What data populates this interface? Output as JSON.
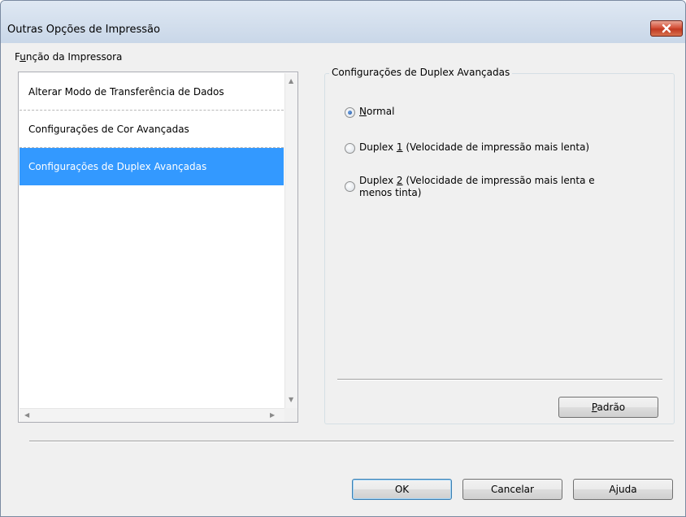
{
  "window": {
    "title": "Outras Opções de Impressão"
  },
  "left_panel": {
    "group_label_prefix": "F",
    "group_label_accel": "u",
    "group_label_suffix": "nção da Impressora",
    "items": [
      {
        "label": "Alterar Modo de Transferência de Dados",
        "selected": false
      },
      {
        "label": "Configurações de Cor Avançadas",
        "selected": false
      },
      {
        "label": "Configurações de Duplex Avançadas",
        "selected": true
      }
    ]
  },
  "right_panel": {
    "group_title": "Configurações de Duplex Avançadas",
    "options": [
      {
        "accel": "N",
        "label_rest": "ormal",
        "prefix": "",
        "checked": true
      },
      {
        "prefix": "Duplex ",
        "accel": "1",
        "label_rest": " (Velocidade de impressão mais lenta)",
        "checked": false
      },
      {
        "prefix": "Duplex ",
        "accel": "2",
        "label_rest": " (Velocidade de impressão mais lenta e",
        "line2": "menos tinta)",
        "checked": false
      }
    ],
    "default_button": {
      "accel": "P",
      "rest": "adrão"
    }
  },
  "buttons": {
    "ok": "OK",
    "cancel": "Cancelar",
    "help_prefix": "A",
    "help_accel": "j",
    "help_rest": "uda"
  },
  "colors": {
    "selection": "#3399ff",
    "close_button": "#c9462c"
  }
}
